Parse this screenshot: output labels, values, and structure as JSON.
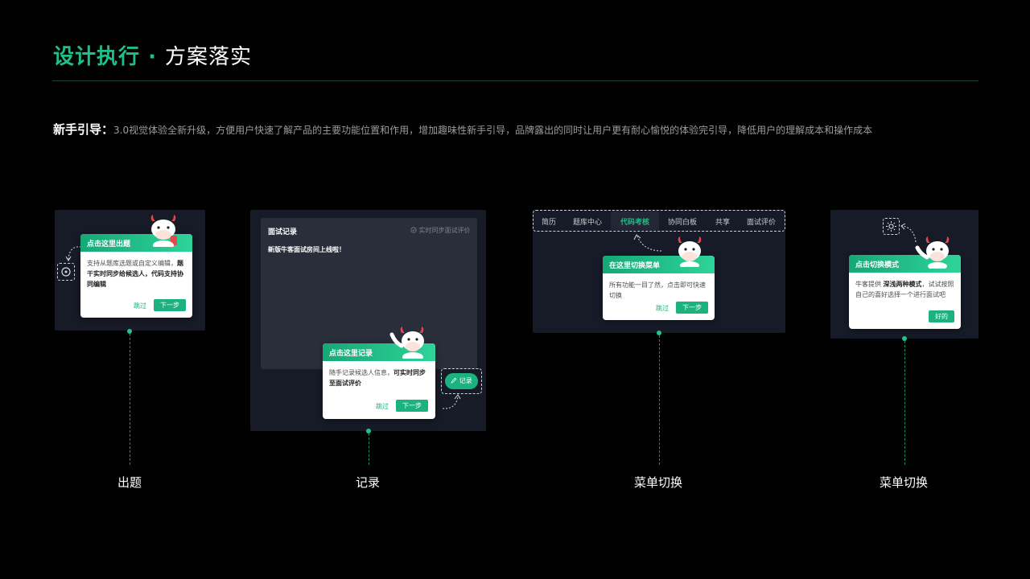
{
  "header": {
    "title_green": "设计执行",
    "title_dot": " · ",
    "title_white": "方案落实"
  },
  "intro": {
    "label": "新手引导：",
    "text": "3.0视觉体验全新升级，方便用户快速了解产品的主要功能位置和作用，增加趣味性新手引导，品牌露出的同时让用户更有耐心愉悦的体验完引导，降低用户的理解成本和操作成本"
  },
  "cards": {
    "chuti": {
      "caption": "出题",
      "head": "点击这里出题",
      "body_normal": "支持从题库选题或自定义编辑，",
      "body_bold": "题干实时同步给候选人，代码支持协同编辑",
      "skip": "跳过",
      "next": "下一步"
    },
    "jilu": {
      "caption": "记录",
      "window_title": "面试记录",
      "sync_status": "实时同步面试评价",
      "window_text": "新版牛客面试房间上线啦！",
      "head": "点击这里记录",
      "body_normal": "随手记录候选人信息，",
      "body_bold": "可实时同步至面试评价",
      "skip": "跳过",
      "next": "下一步",
      "record_button": "记录"
    },
    "menu": {
      "caption": "菜单切换",
      "tabs": [
        "简历",
        "题库中心",
        "代码考核",
        "协同白板",
        "共享",
        "面试评价"
      ],
      "active_tab": "代码考核",
      "head": "在这里切换菜单",
      "body": "所有功能一目了然，点击即可快速切换",
      "skip": "跳过",
      "next": "下一步"
    },
    "mode": {
      "caption": "菜单切换",
      "head": "点击切换模式",
      "body_pre": "牛客提供 ",
      "body_bold": "深浅两种模式",
      "body_post": "，试试按照自己的喜好选择一个进行面试吧",
      "ok": "好的"
    }
  },
  "colors": {
    "accent": "#1ec087",
    "background": "#010101",
    "panel": "#171b27"
  }
}
